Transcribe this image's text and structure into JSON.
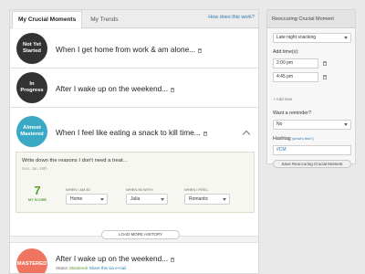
{
  "tabs": {
    "active": "My Crucial Moments",
    "inactive": "My Trends",
    "help_link": "How does this work?"
  },
  "moments": [
    {
      "status": "Not Yet Started",
      "status_lines": [
        "Not Yet",
        "Started"
      ],
      "color": "#333333",
      "title": "When I get home from work & am alone..."
    },
    {
      "status": "In Progress",
      "status_lines": [
        "In",
        "Progress"
      ],
      "color": "#333333",
      "title": "After I wake up on the weekend..."
    },
    {
      "status": "Almost Mastered",
      "status_lines": [
        "Almost",
        "Mastered"
      ],
      "color": "#3aa9c4",
      "title": "When I feel like eating a snack to kill time..."
    },
    {
      "status": "MASTERED",
      "status_lines": [
        "MASTERED"
      ],
      "color": "#f07560",
      "title": "After I wake up on the weekend...",
      "status_label": "Status:",
      "status_value": "Mastered!",
      "share_link": "Share this via e-mail"
    }
  ],
  "detail": {
    "prompt": "Write down the reasons I don't need a treat...",
    "date": "Sun, Jan 18th",
    "score": "7",
    "score_label": "MY SCORE",
    "fields": [
      {
        "label": "WHEN I AM AT:",
        "value": "Home"
      },
      {
        "label": "WHEN IM WITH:",
        "value": "Julia"
      },
      {
        "label": "WHEN I FEEL:",
        "value": "Romantic"
      }
    ]
  },
  "load_more": "LOAD MORE HISTORY",
  "sidebar": {
    "header": "Reoccuring Crucial Moment",
    "moment_select": "Late night snacking",
    "add_time_label": "Add time(s):",
    "times": [
      "2:00 pm",
      "4:45 pm"
    ],
    "add_new": "Add new",
    "reminder_label": "Want a reminder?",
    "reminder_value": "No",
    "hashtag_label": "Hashtag",
    "hashtag_hint": "(what's this?)",
    "hashtag_value": "#CM",
    "save_button": "Save Reoccuring Crucial Moment"
  }
}
